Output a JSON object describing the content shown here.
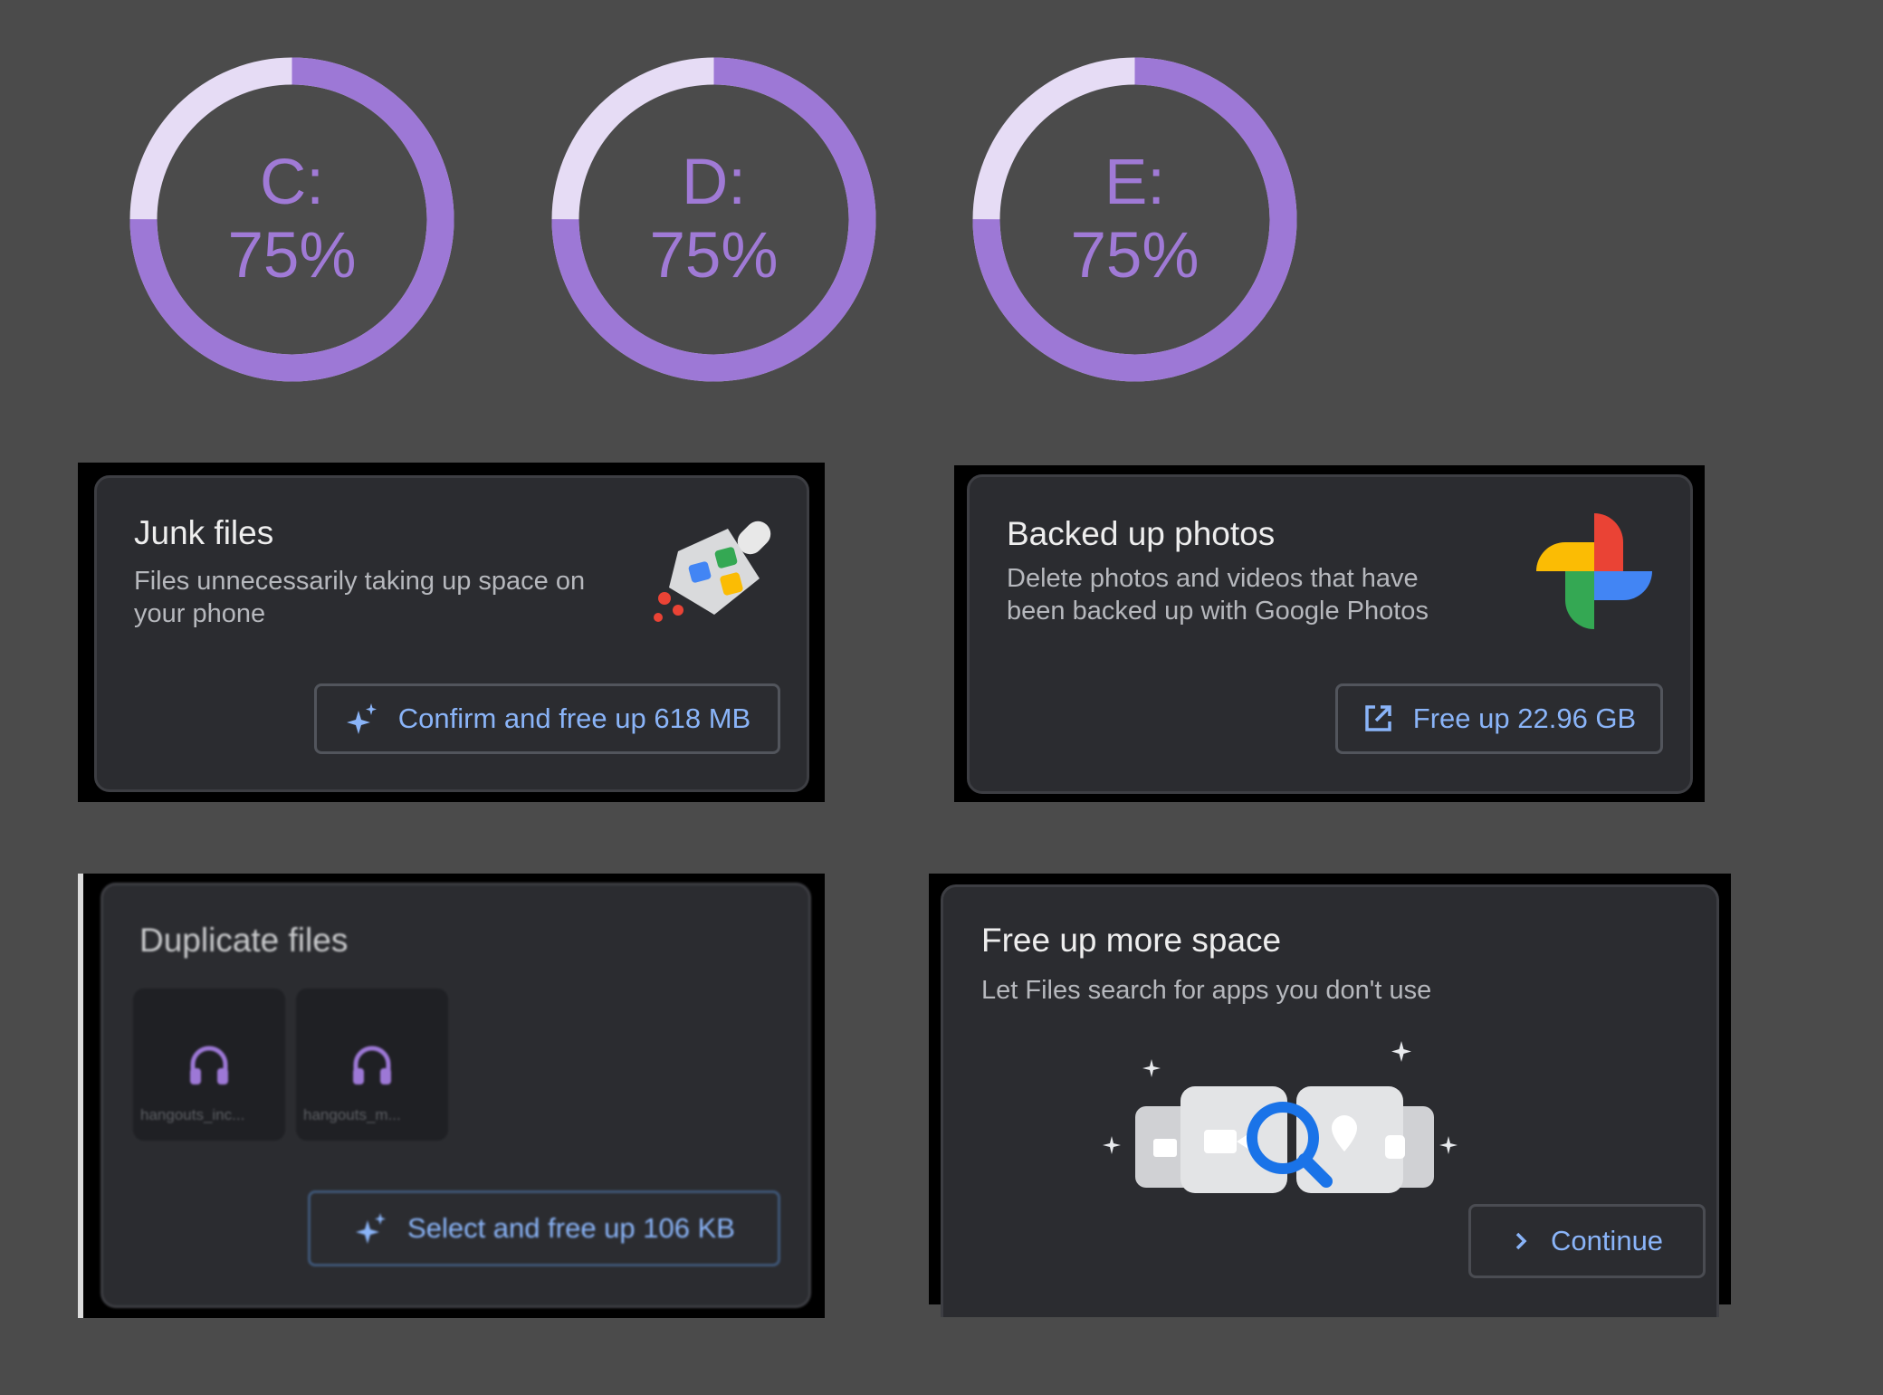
{
  "drives": [
    {
      "label": "C:",
      "percent_text": "75%",
      "usage_fraction": 0.75
    },
    {
      "label": "D:",
      "percent_text": "75%",
      "usage_fraction": 0.75
    },
    {
      "label": "E:",
      "percent_text": "75%",
      "usage_fraction": 0.75
    }
  ],
  "colors": {
    "background": "#4b4b4b",
    "ring": "#9d78d6",
    "ring_remaining": "#e6dcf5",
    "card": "#2b2c30",
    "button_text": "#8ab4f8",
    "search_blue": "#1a73e8"
  },
  "cards": {
    "junk": {
      "title": "Junk files",
      "description": "Files unnecessarily taking up space on your phone",
      "icon": "broom-dustpan-icon",
      "button_label": "Confirm and free up 618 MB",
      "button_icon": "sparkle-icon"
    },
    "photos": {
      "title": "Backed up photos",
      "description": "Delete photos and videos that have been backed up with Google Photos",
      "icon": "google-photos-pinwheel-icon",
      "button_label": "Free up 22.96 GB",
      "button_icon": "open-external-icon"
    },
    "duplicates": {
      "title": "Duplicate files",
      "files": [
        {
          "name": "hangouts_inc...",
          "icon": "headphones-icon"
        },
        {
          "name": "hangouts_m...",
          "icon": "headphones-icon"
        }
      ],
      "button_label": "Select and free up 106 KB",
      "button_icon": "sparkle-icon"
    },
    "more_space": {
      "title": "Free up more space",
      "description": "Let Files search for apps you don't use",
      "illustration": "app-search-illustration",
      "button_label": "Continue",
      "button_icon": "chevron-right-icon"
    }
  }
}
